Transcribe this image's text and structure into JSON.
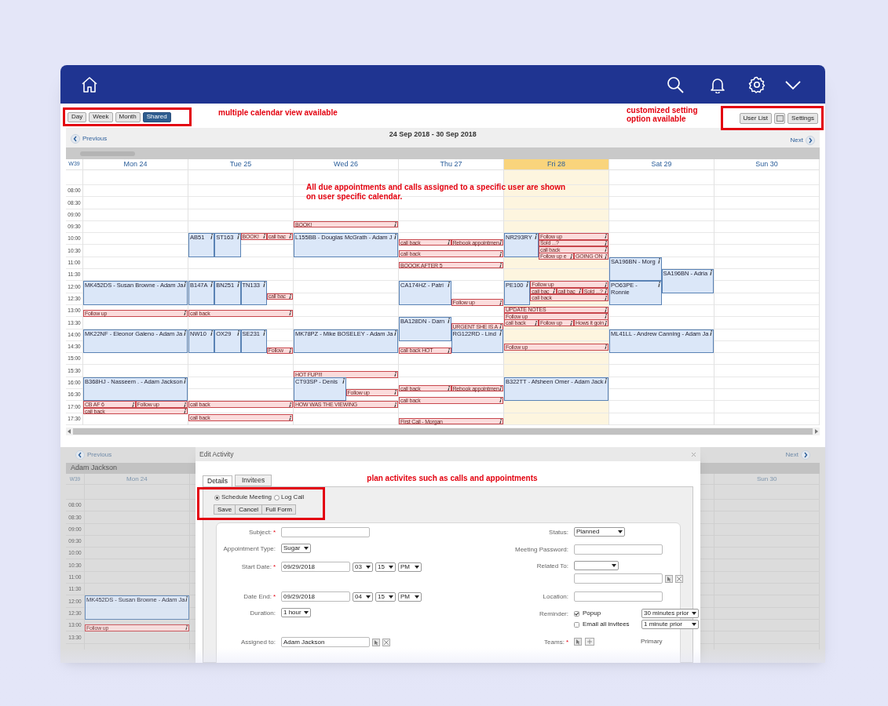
{
  "view_tabs": [
    {
      "label": "Day",
      "selected": false
    },
    {
      "label": "Week",
      "selected": false
    },
    {
      "label": "Month",
      "selected": false
    },
    {
      "label": "Shared",
      "selected": true
    }
  ],
  "notes": {
    "views": "multiple calendar view available",
    "settings": "customized setting option available",
    "calendar": "All due appointments and calls assigned to a specific user are shown on user specific calendar."
  },
  "toolbar_buttons": [
    "User List",
    "Settings"
  ],
  "nav": {
    "previous": "Previous",
    "range": "24 Sep 2018 - 30 Sep 2018",
    "next": "Next"
  },
  "calendar": {
    "week": "W39",
    "times": [
      "08:00",
      "08:30",
      "09:00",
      "09:30",
      "10:00",
      "10:30",
      "11:00",
      "11:30",
      "12:00",
      "12:30",
      "13:00",
      "13:30",
      "14:00",
      "14:30",
      "15:00",
      "15:30",
      "16:00",
      "16:30",
      "17:00",
      "17:30"
    ],
    "days": [
      {
        "label": "Mon 24",
        "today": false,
        "events": [
          {
            "title": "MK452DS - Susan Browne - Adam Ja",
            "kind": "appointment"
          },
          {
            "title": "Follow up",
            "kind": "call"
          },
          {
            "title": "MK22NF - Eleonor Galeno - Adam Ja",
            "kind": "appointment"
          },
          {
            "title": "B368HJ - Nasseem . - Adam Jackson",
            "kind": "appointment"
          },
          {
            "title": "CB AF 6",
            "kind": "call"
          },
          {
            "title": "Follow up",
            "kind": "call"
          },
          {
            "title": "call back",
            "kind": "call"
          }
        ]
      },
      {
        "label": "Tue 25",
        "today": false,
        "events": [
          {
            "title": "AB51",
            "kind": "appointment"
          },
          {
            "title": "ST163",
            "kind": "appointment"
          },
          {
            "title": "BOOK!",
            "kind": "call"
          },
          {
            "title": "call bac",
            "kind": "call"
          },
          {
            "title": "B147A",
            "kind": "appointment"
          },
          {
            "title": "BN251",
            "kind": "appointment"
          },
          {
            "title": "TN133",
            "kind": "appointment"
          },
          {
            "title": "call bac",
            "kind": "call"
          },
          {
            "title": "call back",
            "kind": "call"
          },
          {
            "title": "NW10",
            "kind": "appointment"
          },
          {
            "title": "OX29",
            "kind": "appointment"
          },
          {
            "title": "SE231",
            "kind": "appointment"
          },
          {
            "title": "Follow",
            "kind": "call"
          },
          {
            "title": "call back",
            "kind": "call"
          },
          {
            "title": "call back",
            "kind": "call"
          }
        ]
      },
      {
        "label": "Wed 26",
        "today": false,
        "events": [
          {
            "title": "BOOK!",
            "kind": "call"
          },
          {
            "title": "L155BB - Douglas McGrath - Adam J",
            "kind": "appointment"
          },
          {
            "title": "MK78PZ - Mike BOSELEY - Adam Ja",
            "kind": "appointment"
          },
          {
            "title": "HOT FUP!!!",
            "kind": "call"
          },
          {
            "title": "CT93SP - Denis",
            "kind": "appointment"
          },
          {
            "title": "Follow up",
            "kind": "call"
          },
          {
            "title": "HOW WAS THE VIEWING",
            "kind": "call"
          }
        ]
      },
      {
        "label": "Thu 27",
        "today": false,
        "events": [
          {
            "title": "call back",
            "kind": "call"
          },
          {
            "title": "Rebook appointmen",
            "kind": "call"
          },
          {
            "title": "call back",
            "kind": "call"
          },
          {
            "title": "BOOOK AFTER 5",
            "kind": "call"
          },
          {
            "title": "CA174HZ - Patri",
            "kind": "appointment"
          },
          {
            "title": "Follow up",
            "kind": "call"
          },
          {
            "title": "BA128DN - Darn",
            "kind": "appointment"
          },
          {
            "title": "URGENT SHE IS A",
            "kind": "call"
          },
          {
            "title": "RG122RD - Lind",
            "kind": "appointment"
          },
          {
            "title": "call back HOT",
            "kind": "call"
          },
          {
            "title": "call back",
            "kind": "call"
          },
          {
            "title": "Rebook appointmen",
            "kind": "call"
          },
          {
            "title": "call back",
            "kind": "call"
          },
          {
            "title": "First Call - Morgan",
            "kind": "call"
          }
        ]
      },
      {
        "label": "Fri 28",
        "today": true,
        "events": [
          {
            "title": "NR293RY",
            "kind": "appointment"
          },
          {
            "title": "Follow up",
            "kind": "call"
          },
          {
            "title": "Sold ...?",
            "kind": "call"
          },
          {
            "title": "call back",
            "kind": "call"
          },
          {
            "title": "Follow up e",
            "kind": "call"
          },
          {
            "title": "GOING ON",
            "kind": "call"
          },
          {
            "title": "PE100",
            "kind": "appointment"
          },
          {
            "title": "Follow up",
            "kind": "call"
          },
          {
            "title": "call bac",
            "kind": "call"
          },
          {
            "title": "call bac",
            "kind": "call"
          },
          {
            "title": "Sold ...?",
            "kind": "call"
          },
          {
            "title": "call back",
            "kind": "call"
          },
          {
            "title": "UPDATE NOTES",
            "kind": "call"
          },
          {
            "title": "Follow up",
            "kind": "call"
          },
          {
            "title": "call back",
            "kind": "call"
          },
          {
            "title": "Follow up",
            "kind": "call"
          },
          {
            "title": "Hows it goin",
            "kind": "call"
          },
          {
            "title": "Follow up",
            "kind": "call"
          },
          {
            "title": "B322TT - Afsheen Omer - Adam Jack",
            "kind": "appointment"
          }
        ]
      },
      {
        "label": "Sat 29",
        "today": false,
        "events": [
          {
            "title": "SA196BN - Morg",
            "kind": "appointment"
          },
          {
            "title": "SA196BN - Adria",
            "kind": "appointment"
          },
          {
            "title": "PO63PE - Ronnie",
            "kind": "appointment"
          },
          {
            "title": "ML41LL - Andrew Canning - Adam Ja",
            "kind": "appointment"
          }
        ]
      },
      {
        "label": "Sun 30",
        "today": false
      }
    ]
  },
  "background_calendar": {
    "previous": "Previous",
    "next": "Next",
    "user": "Adam Jackson",
    "week": "W39",
    "days": [
      "Mon 24",
      "Sun 30"
    ],
    "times": [
      "08:00",
      "08:30",
      "09:00",
      "09:30",
      "10:00",
      "10:30",
      "11:00",
      "11:30",
      "12:00",
      "12:30",
      "13:00",
      "13:30"
    ],
    "events": [
      {
        "title": "MK452DS - Susan Browne - Adam Ja",
        "kind": "appointment"
      },
      {
        "title": "Follow up",
        "kind": "call"
      }
    ]
  },
  "dialog": {
    "title": "Edit Activity",
    "tabs": [
      {
        "label": "Details",
        "selected": true
      },
      {
        "label": "Invitees",
        "selected": false
      }
    ],
    "note": "plan activites such as calls and appointments",
    "activity_types": [
      {
        "label": "Schedule Meeting",
        "selected": true
      },
      {
        "label": "Log Call",
        "selected": false
      }
    ],
    "buttons": [
      "Save",
      "Cancel",
      "Full Form"
    ],
    "left_fields": [
      {
        "label": "Subject:",
        "required_mark": "*",
        "kind": "text"
      },
      {
        "label": "Appointment Type:",
        "kind": "select",
        "value": "Sugar"
      },
      {
        "label": "Start Date:",
        "required_mark": "*",
        "kind": "datetime",
        "value": "09/29/2018",
        "hour": "03",
        "minute": "15",
        "meridiem": "PM"
      },
      {
        "label": "Date End:",
        "required_mark": "*",
        "kind": "datetime",
        "value": "09/29/2018",
        "hour": "04",
        "minute": "15",
        "meridiem": "PM"
      },
      {
        "label": "Duration:",
        "kind": "select",
        "value": "1 hour"
      },
      {
        "label": "Assigned to:",
        "kind": "lookup",
        "value": "Adam Jackson"
      }
    ],
    "right_fields": [
      {
        "label": "Status:",
        "kind": "select",
        "value": "Planned"
      },
      {
        "label": "Meeting Password:",
        "kind": "text"
      },
      {
        "label": "Related To:",
        "kind": "related"
      },
      {
        "label": "Location:",
        "kind": "text"
      },
      {
        "label": "Reminder:",
        "kind": "reminder",
        "options": [
          {
            "label": "Popup",
            "checked": true,
            "value": "30 minutes prior"
          },
          {
            "label": "Email all invitees",
            "checked": false,
            "value": "1 minute prior"
          }
        ]
      },
      {
        "label": "Teams:",
        "required_mark": "*",
        "kind": "teams",
        "value": "Primary"
      }
    ]
  }
}
